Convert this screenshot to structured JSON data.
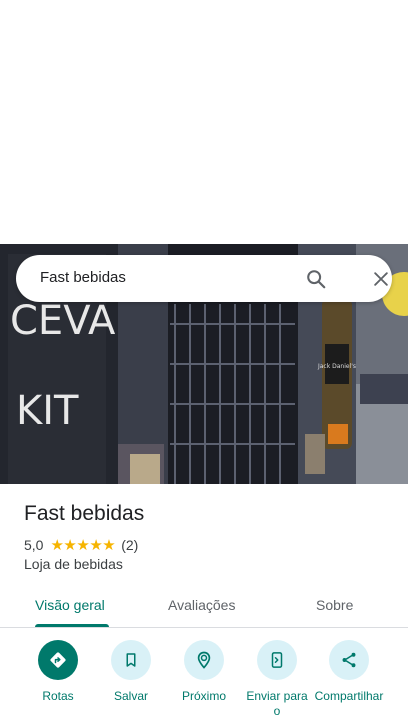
{
  "search": {
    "query": "Fast bebidas"
  },
  "place": {
    "name": "Fast bebidas",
    "rating": "5,0",
    "stars": 5,
    "review_count": "(2)",
    "category": "Loja de bebidas"
  },
  "photo": {
    "wall_text_1": "CEVA",
    "wall_text_2": "KIT",
    "bottle_label": "Jack Daniel's"
  },
  "tabs": [
    {
      "label": "Visão geral",
      "active": true
    },
    {
      "label": "Avaliações",
      "active": false
    },
    {
      "label": "Sobre",
      "active": false
    }
  ],
  "actions": [
    {
      "label": "Rotas",
      "icon": "directions-icon"
    },
    {
      "label": "Salvar",
      "icon": "bookmark-icon"
    },
    {
      "label": "Próximo",
      "icon": "nearby-icon"
    },
    {
      "label": "Enviar para o",
      "icon": "send-to-phone-icon"
    },
    {
      "label": "Compartilhar",
      "icon": "share-icon"
    }
  ],
  "colors": {
    "accent": "#00796b",
    "action_bg": "#d9f1f7",
    "star": "#f6b400"
  }
}
